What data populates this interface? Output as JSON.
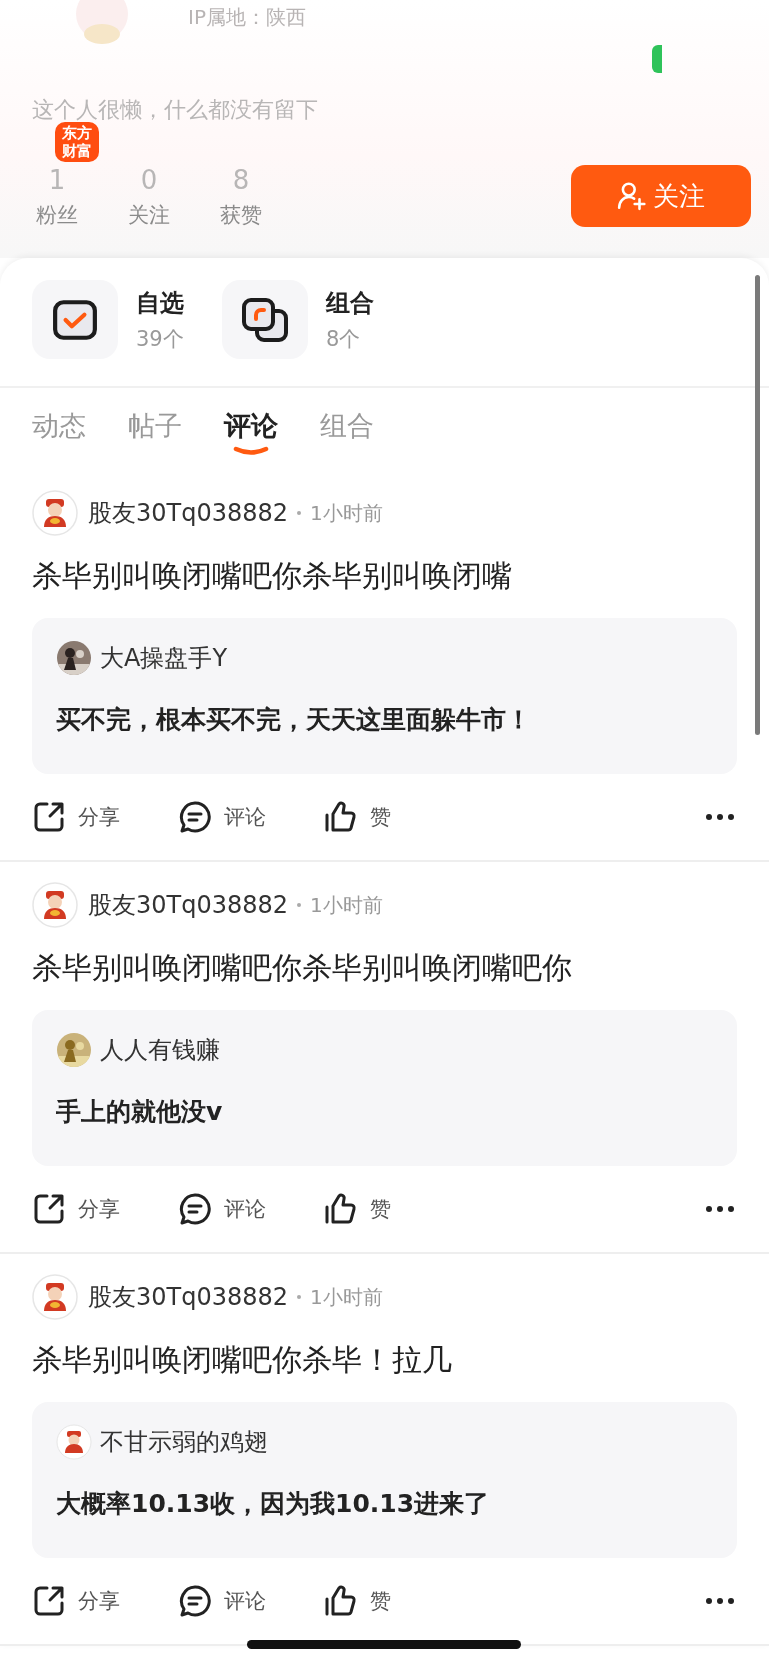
{
  "header": {
    "ip_location": "IP属地：陕西",
    "bio": "这个人很懒，什么都没有留下",
    "app_badge": [
      "东方",
      "财富"
    ],
    "stats": [
      {
        "value": "1",
        "label": "粉丝"
      },
      {
        "value": "0",
        "label": "关注"
      },
      {
        "value": "8",
        "label": "获赞"
      }
    ],
    "follow_button": "关注"
  },
  "shortcuts": [
    {
      "kind": "watchlist",
      "title": "自选",
      "count": "39个"
    },
    {
      "kind": "portfolio",
      "title": "组合",
      "count": "8个"
    }
  ],
  "tabs": [
    {
      "label": "动态",
      "selected": false
    },
    {
      "label": "帖子",
      "selected": false
    },
    {
      "label": "评论",
      "selected": true
    },
    {
      "label": "组合",
      "selected": false
    }
  ],
  "posts": [
    {
      "author": "股友30Tq038882",
      "time": "1小时前",
      "text": "杀毕别叫唤闭嘴吧你杀毕别叫唤闭嘴",
      "reply": {
        "author": "大A操盘手Y",
        "text": "买不完，根本买不完，天天这里面躲牛市！"
      },
      "actions": [
        {
          "kind": "share",
          "label": "分享"
        },
        {
          "kind": "comment",
          "label": "评论"
        },
        {
          "kind": "like",
          "label": "赞"
        }
      ]
    },
    {
      "author": "股友30Tq038882",
      "time": "1小时前",
      "text": "杀毕别叫唤闭嘴吧你杀毕别叫唤闭嘴吧你",
      "reply": {
        "author": "人人有钱赚",
        "text": "手上的就他没v"
      },
      "actions": [
        {
          "kind": "share",
          "label": "分享"
        },
        {
          "kind": "comment",
          "label": "评论"
        },
        {
          "kind": "like",
          "label": "赞"
        }
      ]
    },
    {
      "author": "股友30Tq038882",
      "time": "1小时前",
      "text": "杀毕别叫唤闭嘴吧你杀毕！拉几",
      "reply": {
        "author": "不甘示弱的鸡翅",
        "kind": "mascot",
        "text": "大概率10.13收，因为我10.13进来了"
      },
      "actions": [
        {
          "kind": "share",
          "label": "分享"
        },
        {
          "kind": "comment",
          "label": "评论"
        },
        {
          "kind": "like",
          "label": "赞"
        }
      ]
    }
  ]
}
